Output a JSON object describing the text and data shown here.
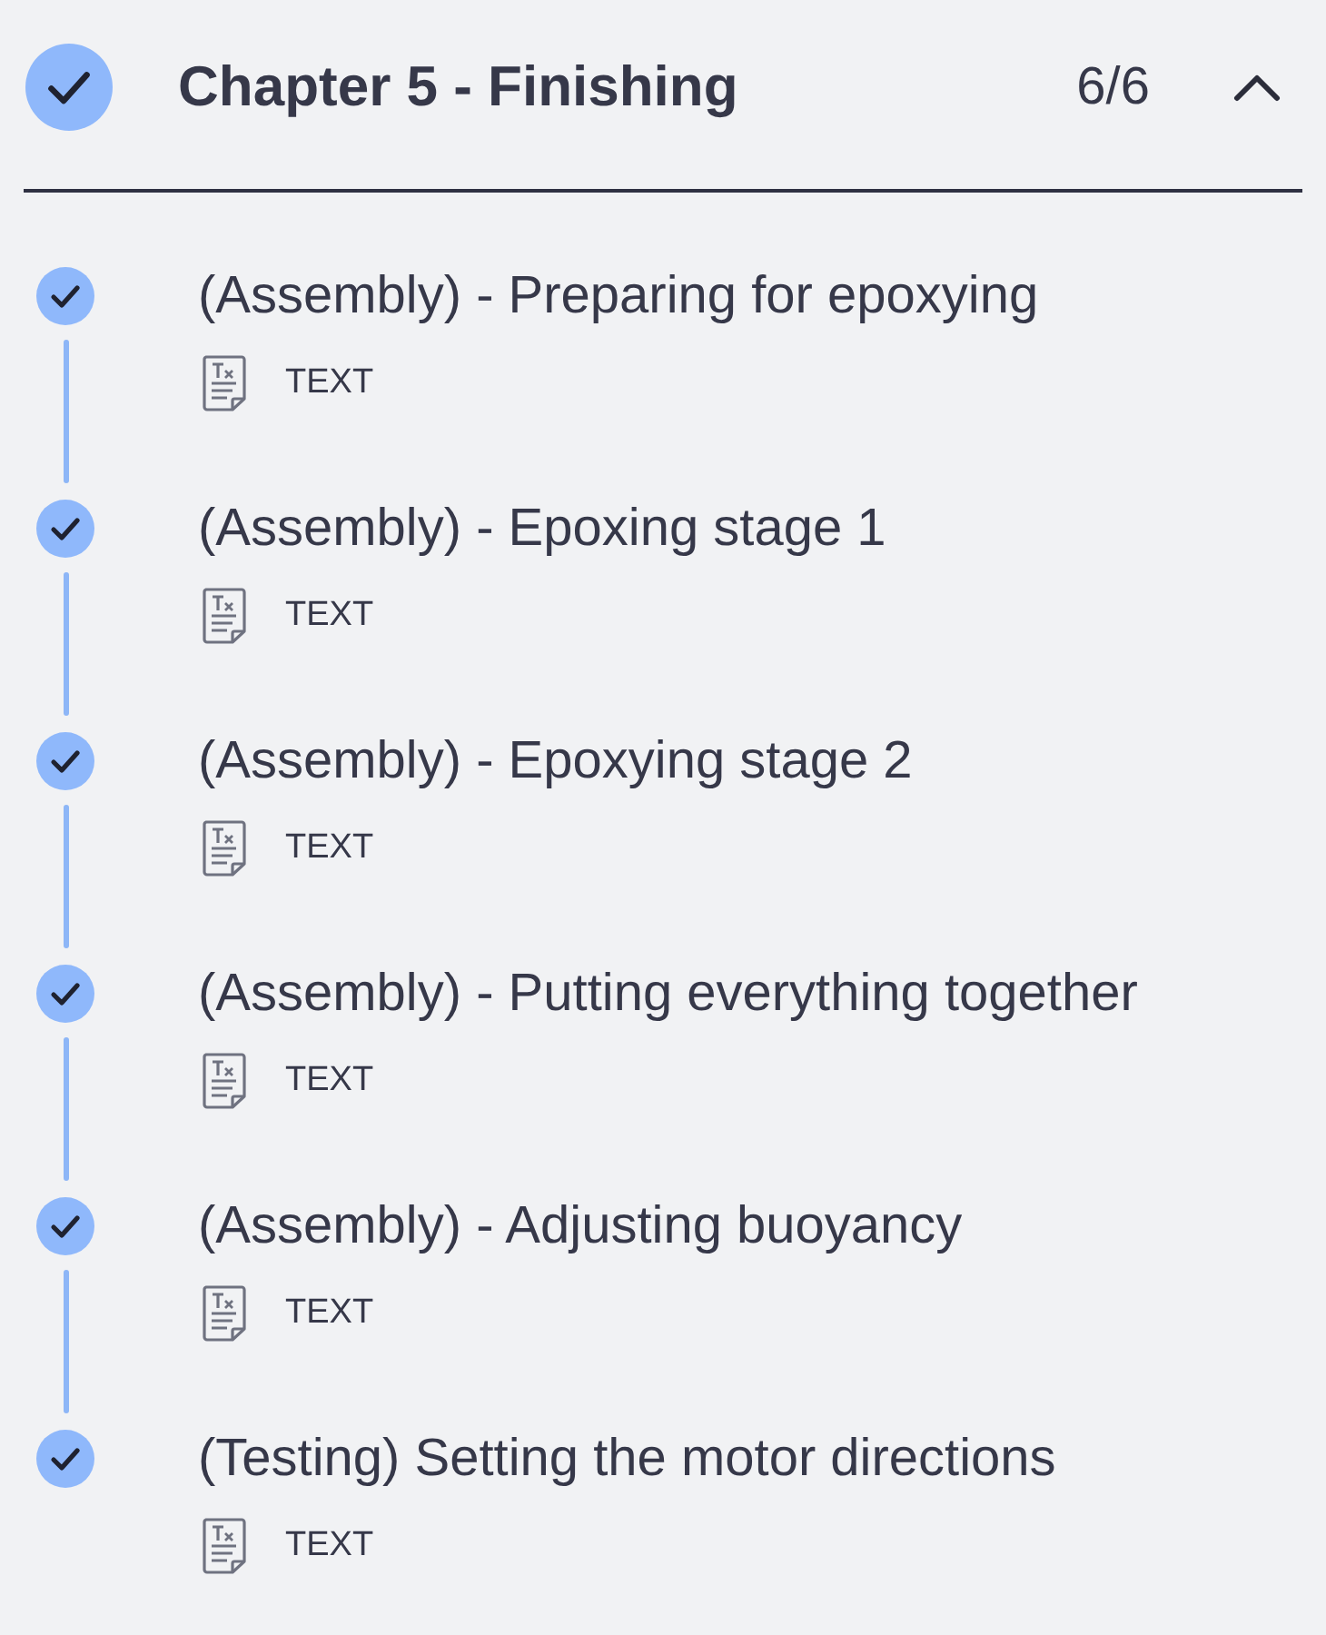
{
  "chapter": {
    "completed": true,
    "title": "Chapter 5 - Finishing",
    "progress": "6/6",
    "expanded": true
  },
  "lessons": [
    {
      "title": "(Assembly) - Preparing for epoxying",
      "completed": true,
      "type_label": "TEXT"
    },
    {
      "title": "(Assembly) - Epoxing stage 1",
      "completed": true,
      "type_label": "TEXT"
    },
    {
      "title": "(Assembly) - Epoxying stage 2",
      "completed": true,
      "type_label": "TEXT"
    },
    {
      "title": "(Assembly) - Putting everything together",
      "completed": true,
      "type_label": "TEXT"
    },
    {
      "title": "(Assembly) - Adjusting buoyancy",
      "completed": true,
      "type_label": "TEXT"
    },
    {
      "title": "(Testing) Setting the motor directions",
      "completed": true,
      "type_label": "TEXT"
    }
  ]
}
